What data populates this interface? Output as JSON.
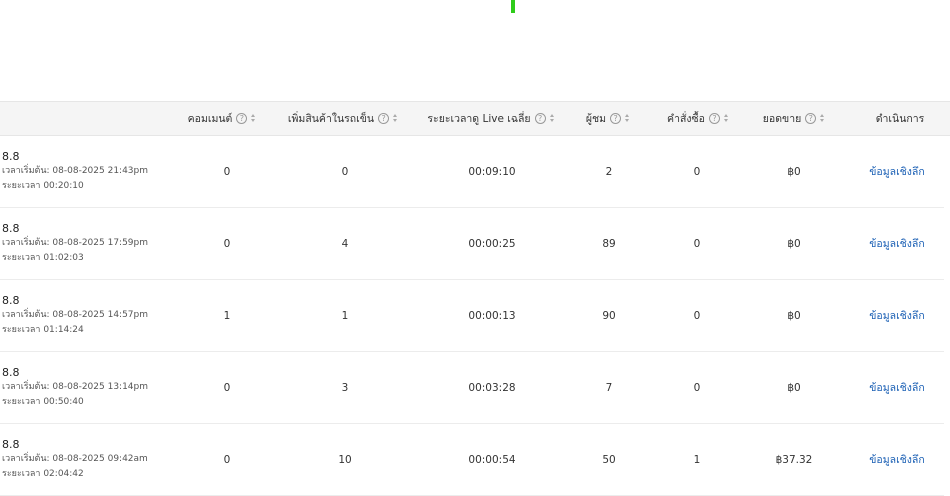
{
  "table": {
    "columns": [
      {
        "label": "คอมเมนต์",
        "help_icon": "question-circle-icon",
        "sortable": true
      },
      {
        "label": "เพิ่มสินค้าในรถเข็น",
        "help_icon": "question-circle-icon",
        "sortable": true
      },
      {
        "label": "ระยะเวลาดู Live เฉลี่ย",
        "help_icon": "question-circle-icon",
        "sortable": true
      },
      {
        "label": "ผู้ชม",
        "help_icon": "question-circle-icon",
        "sortable": true
      },
      {
        "label": "คำสั่งซื้อ",
        "help_icon": "question-circle-icon",
        "sortable": true
      },
      {
        "label": "ยอดขาย",
        "help_icon": "question-circle-icon",
        "sortable": true
      },
      {
        "label": "ดำเนินการ",
        "sortable": false
      }
    ],
    "rows": [
      {
        "title": "8.8",
        "start": "เวลาเริ่มต้น: 08-08-2025 21:43pm",
        "duration": "ระยะเวลา 00:20:10",
        "comments": "0",
        "add_to_cart": "0",
        "avg_watch": "00:09:10",
        "viewers": "2",
        "orders": "0",
        "sales": "฿0",
        "action": "ข้อมูลเชิงลึก"
      },
      {
        "title": "8.8",
        "start": "เวลาเริ่มต้น: 08-08-2025 17:59pm",
        "duration": "ระยะเวลา 01:02:03",
        "comments": "0",
        "add_to_cart": "4",
        "avg_watch": "00:00:25",
        "viewers": "89",
        "orders": "0",
        "sales": "฿0",
        "action": "ข้อมูลเชิงลึก"
      },
      {
        "title": "8.8",
        "start": "เวลาเริ่มต้น: 08-08-2025 14:57pm",
        "duration": "ระยะเวลา 01:14:24",
        "comments": "1",
        "add_to_cart": "1",
        "avg_watch": "00:00:13",
        "viewers": "90",
        "orders": "0",
        "sales": "฿0",
        "action": "ข้อมูลเชิงลึก"
      },
      {
        "title": "8.8",
        "start": "เวลาเริ่มต้น: 08-08-2025 13:14pm",
        "duration": "ระยะเวลา 00:50:40",
        "comments": "0",
        "add_to_cart": "3",
        "avg_watch": "00:03:28",
        "viewers": "7",
        "orders": "0",
        "sales": "฿0",
        "action": "ข้อมูลเชิงลึก"
      },
      {
        "title": "8.8",
        "start": "เวลาเริ่มต้น: 08-08-2025 09:42am",
        "duration": "ระยะเวลา 02:04:42",
        "comments": "0",
        "add_to_cart": "10",
        "avg_watch": "00:00:54",
        "viewers": "50",
        "orders": "1",
        "sales": "฿37.32",
        "action": "ข้อมูลเชิงลึก"
      }
    ]
  },
  "colors": {
    "link": "#1a5fb4",
    "marker": "#2ecc1a",
    "header_bg": "#f5f5f5"
  }
}
